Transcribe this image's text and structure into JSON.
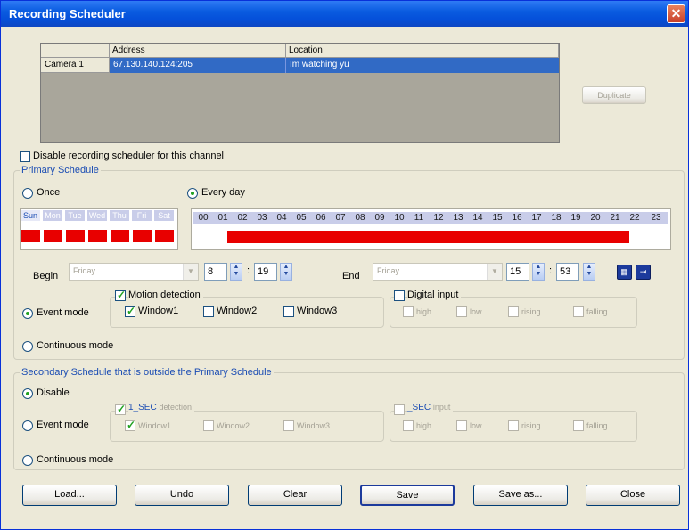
{
  "window": {
    "title": "Recording Scheduler",
    "close_glyph": "✕"
  },
  "camera_table": {
    "headers": [
      "",
      "Address",
      "Location"
    ],
    "rows": [
      [
        "Camera 1",
        "67.130.140.124:205",
        "Im watching yu"
      ]
    ]
  },
  "duplicate_label": "Duplicate",
  "disable_channel_label": "Disable recording scheduler for this channel",
  "primary": {
    "title": "Primary Schedule",
    "once_label": "Once",
    "everyday_label": "Every day",
    "days": [
      "Sun",
      "Mon",
      "Tue",
      "Wed",
      "Thu",
      "Fri",
      "Sat"
    ],
    "hours": [
      "00",
      "01",
      "02",
      "03",
      "04",
      "05",
      "06",
      "07",
      "08",
      "09",
      "10",
      "11",
      "12",
      "13",
      "14",
      "15",
      "16",
      "17",
      "18",
      "19",
      "20",
      "21",
      "22",
      "23"
    ],
    "begin_label": "Begin",
    "begin_day": "Friday",
    "begin_hour": "8",
    "begin_min": "19",
    "end_label": "End",
    "end_day": "Friday",
    "end_hour": "15",
    "end_min": "53",
    "event_mode_label": "Event mode",
    "continuous_mode_label": "Continuous mode",
    "motion_label": "Motion detection",
    "windows": [
      "Window1",
      "Window2",
      "Window3"
    ],
    "digital_label": "Digital input",
    "digital_opts": [
      "high",
      "low",
      "rising",
      "falling"
    ]
  },
  "secondary": {
    "title": "Secondary Schedule that is outside the Primary Schedule",
    "disable_label": "Disable",
    "event_mode_label": "Event mode",
    "continuous_mode_label": "Continuous mode",
    "motion_label": "1_SEC",
    "motion_suffix": "detection",
    "windows": [
      "Window1",
      "Window2",
      "Window3"
    ],
    "digital_label": "_SEC",
    "digital_suffix": "input",
    "digital_opts": [
      "high",
      "low",
      "rising",
      "falling"
    ]
  },
  "buttons": {
    "load": "Load...",
    "undo": "Undo",
    "clear": "Clear",
    "save": "Save",
    "save_as": "Save as...",
    "close": "Close"
  },
  "colors": {
    "schedule_red": "#E80000",
    "day_header": "#C9CDE9",
    "group_title": "#1A4CB3"
  }
}
